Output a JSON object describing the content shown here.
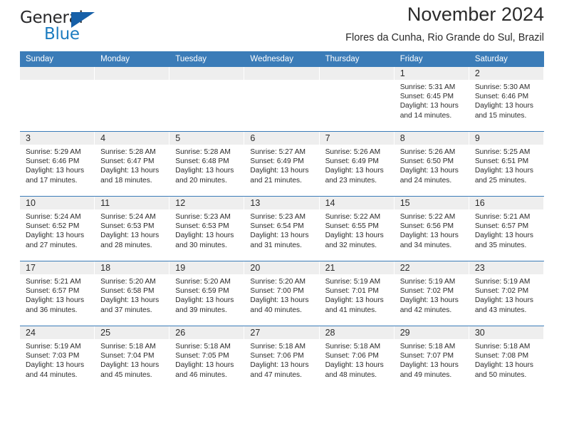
{
  "brand": {
    "name_part1": "General",
    "name_part2": "Blue",
    "accent_color": "#1c7cc0",
    "triangle_color": "#1760a8",
    "triangle_icon": "triangle-icon"
  },
  "header": {
    "title": "November 2024",
    "subtitle": "Flores da Cunha, Rio Grande do Sul, Brazil"
  },
  "calendar": {
    "header_bg": "#3b7cb8",
    "daystrip_bg": "#eeeeee",
    "weekday_headers": [
      "Sunday",
      "Monday",
      "Tuesday",
      "Wednesday",
      "Thursday",
      "Friday",
      "Saturday"
    ],
    "weeks": [
      [
        {
          "day": "",
          "empty": true
        },
        {
          "day": "",
          "empty": true
        },
        {
          "day": "",
          "empty": true
        },
        {
          "day": "",
          "empty": true
        },
        {
          "day": "",
          "empty": true
        },
        {
          "day": "1",
          "sunrise": "Sunrise: 5:31 AM",
          "sunset": "Sunset: 6:45 PM",
          "daylight1": "Daylight: 13 hours",
          "daylight2": "and 14 minutes."
        },
        {
          "day": "2",
          "sunrise": "Sunrise: 5:30 AM",
          "sunset": "Sunset: 6:46 PM",
          "daylight1": "Daylight: 13 hours",
          "daylight2": "and 15 minutes."
        }
      ],
      [
        {
          "day": "3",
          "sunrise": "Sunrise: 5:29 AM",
          "sunset": "Sunset: 6:46 PM",
          "daylight1": "Daylight: 13 hours",
          "daylight2": "and 17 minutes."
        },
        {
          "day": "4",
          "sunrise": "Sunrise: 5:28 AM",
          "sunset": "Sunset: 6:47 PM",
          "daylight1": "Daylight: 13 hours",
          "daylight2": "and 18 minutes."
        },
        {
          "day": "5",
          "sunrise": "Sunrise: 5:28 AM",
          "sunset": "Sunset: 6:48 PM",
          "daylight1": "Daylight: 13 hours",
          "daylight2": "and 20 minutes."
        },
        {
          "day": "6",
          "sunrise": "Sunrise: 5:27 AM",
          "sunset": "Sunset: 6:49 PM",
          "daylight1": "Daylight: 13 hours",
          "daylight2": "and 21 minutes."
        },
        {
          "day": "7",
          "sunrise": "Sunrise: 5:26 AM",
          "sunset": "Sunset: 6:49 PM",
          "daylight1": "Daylight: 13 hours",
          "daylight2": "and 23 minutes."
        },
        {
          "day": "8",
          "sunrise": "Sunrise: 5:26 AM",
          "sunset": "Sunset: 6:50 PM",
          "daylight1": "Daylight: 13 hours",
          "daylight2": "and 24 minutes."
        },
        {
          "day": "9",
          "sunrise": "Sunrise: 5:25 AM",
          "sunset": "Sunset: 6:51 PM",
          "daylight1": "Daylight: 13 hours",
          "daylight2": "and 25 minutes."
        }
      ],
      [
        {
          "day": "10",
          "sunrise": "Sunrise: 5:24 AM",
          "sunset": "Sunset: 6:52 PM",
          "daylight1": "Daylight: 13 hours",
          "daylight2": "and 27 minutes."
        },
        {
          "day": "11",
          "sunrise": "Sunrise: 5:24 AM",
          "sunset": "Sunset: 6:53 PM",
          "daylight1": "Daylight: 13 hours",
          "daylight2": "and 28 minutes."
        },
        {
          "day": "12",
          "sunrise": "Sunrise: 5:23 AM",
          "sunset": "Sunset: 6:53 PM",
          "daylight1": "Daylight: 13 hours",
          "daylight2": "and 30 minutes."
        },
        {
          "day": "13",
          "sunrise": "Sunrise: 5:23 AM",
          "sunset": "Sunset: 6:54 PM",
          "daylight1": "Daylight: 13 hours",
          "daylight2": "and 31 minutes."
        },
        {
          "day": "14",
          "sunrise": "Sunrise: 5:22 AM",
          "sunset": "Sunset: 6:55 PM",
          "daylight1": "Daylight: 13 hours",
          "daylight2": "and 32 minutes."
        },
        {
          "day": "15",
          "sunrise": "Sunrise: 5:22 AM",
          "sunset": "Sunset: 6:56 PM",
          "daylight1": "Daylight: 13 hours",
          "daylight2": "and 34 minutes."
        },
        {
          "day": "16",
          "sunrise": "Sunrise: 5:21 AM",
          "sunset": "Sunset: 6:57 PM",
          "daylight1": "Daylight: 13 hours",
          "daylight2": "and 35 minutes."
        }
      ],
      [
        {
          "day": "17",
          "sunrise": "Sunrise: 5:21 AM",
          "sunset": "Sunset: 6:57 PM",
          "daylight1": "Daylight: 13 hours",
          "daylight2": "and 36 minutes."
        },
        {
          "day": "18",
          "sunrise": "Sunrise: 5:20 AM",
          "sunset": "Sunset: 6:58 PM",
          "daylight1": "Daylight: 13 hours",
          "daylight2": "and 37 minutes."
        },
        {
          "day": "19",
          "sunrise": "Sunrise: 5:20 AM",
          "sunset": "Sunset: 6:59 PM",
          "daylight1": "Daylight: 13 hours",
          "daylight2": "and 39 minutes."
        },
        {
          "day": "20",
          "sunrise": "Sunrise: 5:20 AM",
          "sunset": "Sunset: 7:00 PM",
          "daylight1": "Daylight: 13 hours",
          "daylight2": "and 40 minutes."
        },
        {
          "day": "21",
          "sunrise": "Sunrise: 5:19 AM",
          "sunset": "Sunset: 7:01 PM",
          "daylight1": "Daylight: 13 hours",
          "daylight2": "and 41 minutes."
        },
        {
          "day": "22",
          "sunrise": "Sunrise: 5:19 AM",
          "sunset": "Sunset: 7:02 PM",
          "daylight1": "Daylight: 13 hours",
          "daylight2": "and 42 minutes."
        },
        {
          "day": "23",
          "sunrise": "Sunrise: 5:19 AM",
          "sunset": "Sunset: 7:02 PM",
          "daylight1": "Daylight: 13 hours",
          "daylight2": "and 43 minutes."
        }
      ],
      [
        {
          "day": "24",
          "sunrise": "Sunrise: 5:19 AM",
          "sunset": "Sunset: 7:03 PM",
          "daylight1": "Daylight: 13 hours",
          "daylight2": "and 44 minutes."
        },
        {
          "day": "25",
          "sunrise": "Sunrise: 5:18 AM",
          "sunset": "Sunset: 7:04 PM",
          "daylight1": "Daylight: 13 hours",
          "daylight2": "and 45 minutes."
        },
        {
          "day": "26",
          "sunrise": "Sunrise: 5:18 AM",
          "sunset": "Sunset: 7:05 PM",
          "daylight1": "Daylight: 13 hours",
          "daylight2": "and 46 minutes."
        },
        {
          "day": "27",
          "sunrise": "Sunrise: 5:18 AM",
          "sunset": "Sunset: 7:06 PM",
          "daylight1": "Daylight: 13 hours",
          "daylight2": "and 47 minutes."
        },
        {
          "day": "28",
          "sunrise": "Sunrise: 5:18 AM",
          "sunset": "Sunset: 7:06 PM",
          "daylight1": "Daylight: 13 hours",
          "daylight2": "and 48 minutes."
        },
        {
          "day": "29",
          "sunrise": "Sunrise: 5:18 AM",
          "sunset": "Sunset: 7:07 PM",
          "daylight1": "Daylight: 13 hours",
          "daylight2": "and 49 minutes."
        },
        {
          "day": "30",
          "sunrise": "Sunrise: 5:18 AM",
          "sunset": "Sunset: 7:08 PM",
          "daylight1": "Daylight: 13 hours",
          "daylight2": "and 50 minutes."
        }
      ]
    ]
  }
}
